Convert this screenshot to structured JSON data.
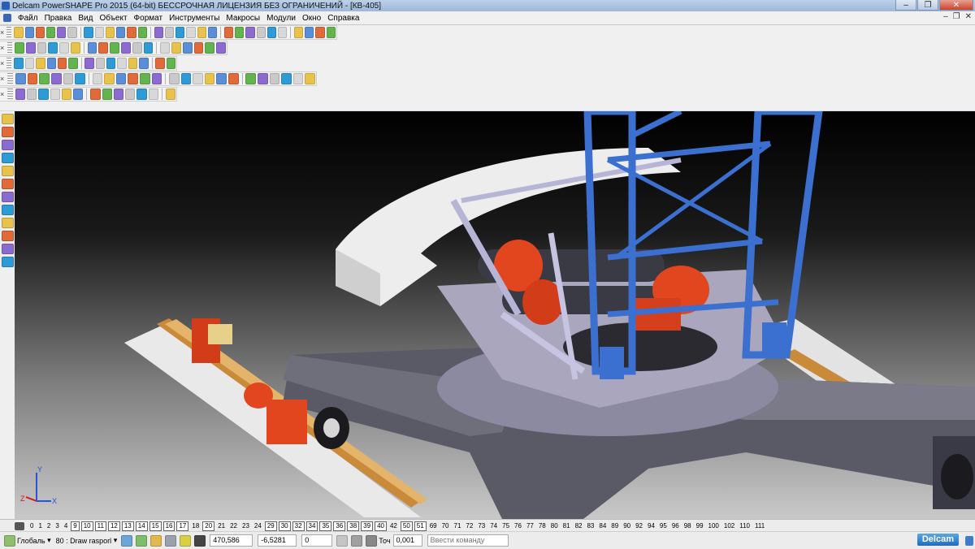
{
  "window": {
    "title": "Delcam PowerSHAPE Pro 2015 (64-bit) БЕССРОЧНАЯ ЛИЦЕНЗИЯ БЕЗ ОГРАНИЧЕНИЙ - [КВ-405]",
    "controls": [
      "–",
      "❐",
      "✕"
    ]
  },
  "menu": {
    "items": [
      "Файл",
      "Правка",
      "Вид",
      "Объект",
      "Формат",
      "Инструменты",
      "Макросы",
      "Модули",
      "Окно",
      "Справка"
    ],
    "doc_controls": [
      "–",
      "❐",
      "✕"
    ]
  },
  "toolbar_colors": [
    "#e8c34c",
    "#5a8ed8",
    "#e06a3a",
    "#63b34f",
    "#8b6bd0",
    "#c9c9c9",
    "#2f9bd6",
    "#d8d8d8"
  ],
  "levels": {
    "items": [
      {
        "label": "0",
        "on": false
      },
      {
        "label": "1",
        "on": false
      },
      {
        "label": "2",
        "on": false
      },
      {
        "label": "3",
        "on": false
      },
      {
        "label": "4",
        "on": false
      },
      {
        "label": "9",
        "on": true
      },
      {
        "label": "10",
        "on": true
      },
      {
        "label": "11",
        "on": true
      },
      {
        "label": "12",
        "on": true
      },
      {
        "label": "13",
        "on": true
      },
      {
        "label": "14",
        "on": true
      },
      {
        "label": "15",
        "on": true
      },
      {
        "label": "16",
        "on": true
      },
      {
        "label": "17",
        "on": true
      },
      {
        "label": "18",
        "on": false
      },
      {
        "label": "20",
        "on": true
      },
      {
        "label": "21",
        "on": false
      },
      {
        "label": "22",
        "on": false
      },
      {
        "label": "23",
        "on": false
      },
      {
        "label": "24",
        "on": false
      },
      {
        "label": "29",
        "on": true
      },
      {
        "label": "30",
        "on": true
      },
      {
        "label": "32",
        "on": true
      },
      {
        "label": "34",
        "on": true
      },
      {
        "label": "35",
        "on": true
      },
      {
        "label": "36",
        "on": true
      },
      {
        "label": "38",
        "on": true
      },
      {
        "label": "39",
        "on": true
      },
      {
        "label": "40",
        "on": true
      },
      {
        "label": "42",
        "on": false
      },
      {
        "label": "50",
        "on": true
      },
      {
        "label": "51",
        "on": true
      },
      {
        "label": "69",
        "on": false
      },
      {
        "label": "70",
        "on": false
      },
      {
        "label": "71",
        "on": false
      },
      {
        "label": "72",
        "on": false
      },
      {
        "label": "73",
        "on": false
      },
      {
        "label": "74",
        "on": false
      },
      {
        "label": "75",
        "on": false
      },
      {
        "label": "76",
        "on": false
      },
      {
        "label": "77",
        "on": false
      },
      {
        "label": "78",
        "on": false
      },
      {
        "label": "80",
        "on": false
      },
      {
        "label": "81",
        "on": false
      },
      {
        "label": "82",
        "on": false
      },
      {
        "label": "83",
        "on": false
      },
      {
        "label": "84",
        "on": false
      },
      {
        "label": "89",
        "on": false
      },
      {
        "label": "90",
        "on": false
      },
      {
        "label": "92",
        "on": false
      },
      {
        "label": "94",
        "on": false
      },
      {
        "label": "95",
        "on": false
      },
      {
        "label": "96",
        "on": false
      },
      {
        "label": "98",
        "on": false
      },
      {
        "label": "99",
        "on": false
      },
      {
        "label": "100",
        "on": false
      },
      {
        "label": "102",
        "on": false
      },
      {
        "label": "110",
        "on": false
      },
      {
        "label": "111",
        "on": false
      }
    ]
  },
  "status": {
    "workplane": "Глобаль",
    "level_select": "80 : Draw rasporl",
    "coord_x": "470,586",
    "coord_y": "-6,5281",
    "coord_z": "0",
    "tolerance_label": "Точ",
    "tolerance_value": "0,001",
    "command_placeholder": "Ввести команду",
    "brand": "Delcam"
  },
  "axis_triad": {
    "x": "X",
    "y": "Y",
    "z": "Z"
  }
}
